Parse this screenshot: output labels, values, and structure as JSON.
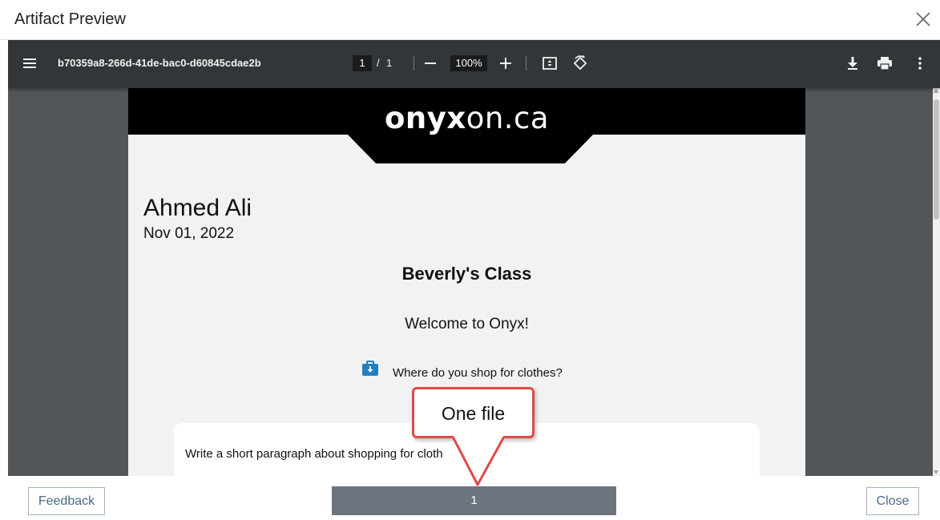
{
  "modal": {
    "title": "Artifact Preview"
  },
  "viewer": {
    "file_name": "b70359a8-266d-41de-bac0-d60845cdae2b",
    "current_page": "1",
    "page_separator": "/",
    "total_pages": "1",
    "zoom": "100%"
  },
  "document": {
    "logo_bold": "onyx",
    "logo_light": "on.ca",
    "student_name": "Ahmed Ali",
    "date": "Nov 01, 2022",
    "class_name": "Beverly's Class",
    "welcome": "Welcome to Onyx!",
    "question": "Where do you shop for clothes?",
    "answer_prompt": "Write a short paragraph about shopping for cloth"
  },
  "footer": {
    "feedback_label": "Feedback",
    "page_label": "1",
    "close_label": "Close"
  },
  "annotation": {
    "callout_text": "One file"
  },
  "colors": {
    "toolbar_bg": "#323639",
    "viewer_bg": "#525659",
    "page_button_bg": "#6c757d",
    "callout_border": "#e04a4a",
    "question_icon": "#1f7fc2"
  }
}
